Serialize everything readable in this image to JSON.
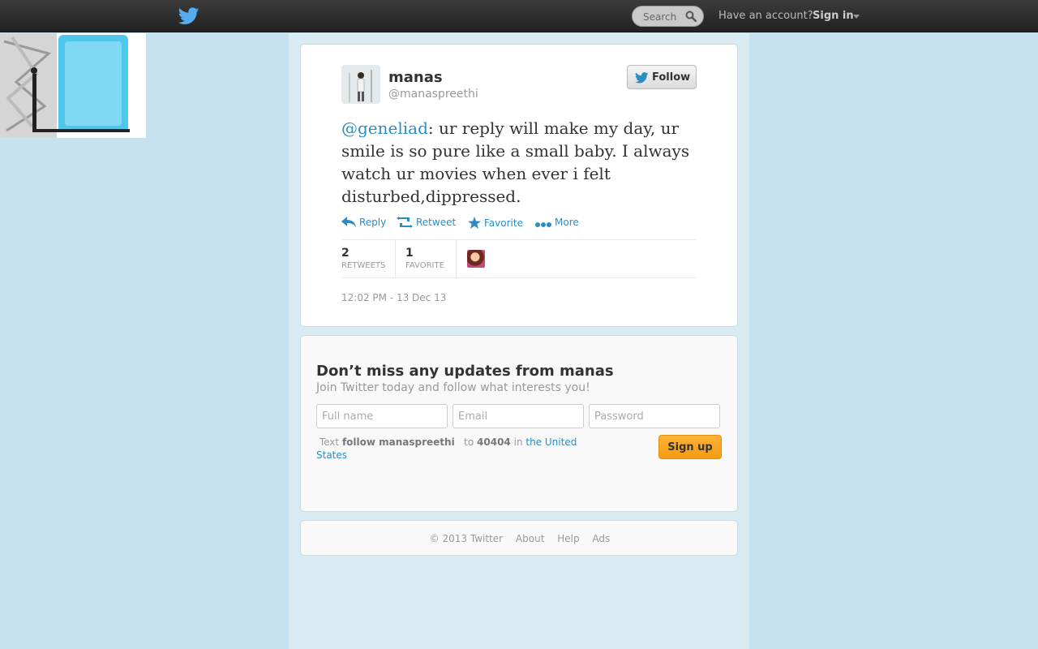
{
  "topbar": {
    "search_placeholder": "Search",
    "have_account": "Have an account?",
    "sign_in": "Sign in"
  },
  "tweet": {
    "fullname": "manas",
    "screenname": "@manaspreethi",
    "follow_label": "Follow",
    "mention": "@geneliad",
    "text": ": ur reply will make my day, ur smile is so pure like a small baby. I always watch ur movies when ever i felt disturbed,dippressed.",
    "actions": {
      "reply": "Reply",
      "retweet": "Retweet",
      "favorite": "Favorite",
      "more": "More"
    },
    "retweets_count": "2",
    "retweets_label": "RETWEETS",
    "favorites_count": "1",
    "favorites_label": "FAVORITE",
    "timestamp": "12:02 PM - 13 Dec 13"
  },
  "signup": {
    "title": "Don’t miss any updates from manas",
    "subtitle": "Join Twitter today and follow what interests you!",
    "fullname_placeholder": "Full name",
    "email_placeholder": "Email",
    "password_placeholder": "Password",
    "text_prefix": "Text",
    "text_command": "follow manaspreethi",
    "text_to": "to",
    "text_number": "40404",
    "text_in": "in",
    "text_country": "the United States",
    "button": "Sign up"
  },
  "footer": {
    "copyright": "© 2013 Twitter",
    "about": "About",
    "help": "Help",
    "ads": "Ads"
  },
  "colors": {
    "link": "#2a8ec2",
    "page_bg": "#c6e2ee",
    "signup_button": "#f39c12"
  }
}
